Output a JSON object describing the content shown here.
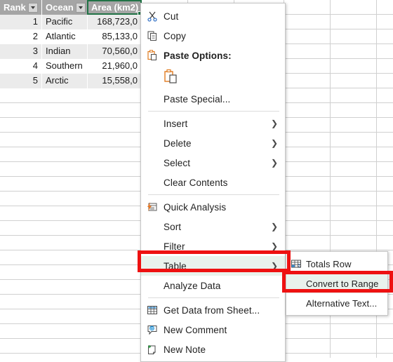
{
  "spreadsheet": {
    "table": {
      "headers": [
        {
          "label": "Rank",
          "filter_icon": "filter-dropdown-icon"
        },
        {
          "label": "Ocean",
          "filter_icon": "filter-dropdown-icon"
        },
        {
          "label": "Area (km2)",
          "filter_icon": "filter-dropdown-icon"
        }
      ],
      "rows": [
        {
          "rank": "1",
          "ocean": "Pacific",
          "area": "168,723,0"
        },
        {
          "rank": "2",
          "ocean": "Atlantic",
          "area": "85,133,0"
        },
        {
          "rank": "3",
          "ocean": "Indian",
          "area": "70,560,0"
        },
        {
          "rank": "4",
          "ocean": "Southern",
          "area": "21,960,0"
        },
        {
          "rank": "5",
          "ocean": "Arctic",
          "area": "15,558,0"
        }
      ],
      "selected_cell": "Area (km2)"
    }
  },
  "context_menu": {
    "items": [
      {
        "label": "Cut",
        "icon": "scissors-icon",
        "arrow": "",
        "bold": false
      },
      {
        "label": "Copy",
        "icon": "copy-icon",
        "arrow": "",
        "bold": false
      },
      {
        "label": "Paste Options:",
        "icon": "clipboard-icon",
        "arrow": "",
        "bold": true
      },
      {
        "label": "Paste Special...",
        "icon": "",
        "arrow": "",
        "bold": false
      },
      {
        "label": "Insert",
        "icon": "",
        "arrow": "❯",
        "bold": false
      },
      {
        "label": "Delete",
        "icon": "",
        "arrow": "❯",
        "bold": false
      },
      {
        "label": "Select",
        "icon": "",
        "arrow": "❯",
        "bold": false
      },
      {
        "label": "Clear Contents",
        "icon": "",
        "arrow": "",
        "bold": false
      },
      {
        "label": "Quick Analysis",
        "icon": "quick-analysis-icon",
        "arrow": "",
        "bold": false
      },
      {
        "label": "Sort",
        "icon": "",
        "arrow": "❯",
        "bold": false
      },
      {
        "label": "Filter",
        "icon": "",
        "arrow": "❯",
        "bold": false
      },
      {
        "label": "Table",
        "icon": "",
        "arrow": "❯",
        "bold": false
      },
      {
        "label": "Analyze Data",
        "icon": "",
        "arrow": "",
        "bold": false
      },
      {
        "label": "Get Data from Sheet...",
        "icon": "get-data-icon",
        "arrow": "",
        "bold": false
      },
      {
        "label": "New Comment",
        "icon": "new-comment-icon",
        "arrow": "",
        "bold": false
      },
      {
        "label": "New Note",
        "icon": "new-note-icon",
        "arrow": "",
        "bold": false
      }
    ],
    "highlighted_item": "Table",
    "paste_gallery_icon": "paste-keep-formatting-icon"
  },
  "submenu": {
    "parent": "Table",
    "items": [
      {
        "label": "Totals Row",
        "icon": "totals-row-icon"
      },
      {
        "label": "Convert to Range",
        "icon": ""
      },
      {
        "label": "Alternative Text...",
        "icon": ""
      }
    ],
    "highlighted_item": "Convert to Range"
  },
  "annotations": {
    "boxes": [
      {
        "target": "Table",
        "color": "#ee1111"
      },
      {
        "target": "Convert to Range",
        "color": "#ee1111"
      }
    ]
  },
  "colors": {
    "annotation_red": "#ee1111",
    "excel_green": "#217346",
    "header_gray": "#a5a5a5",
    "band_gray": "#ebebeb",
    "menu_highlight": "#e9f2ec"
  }
}
